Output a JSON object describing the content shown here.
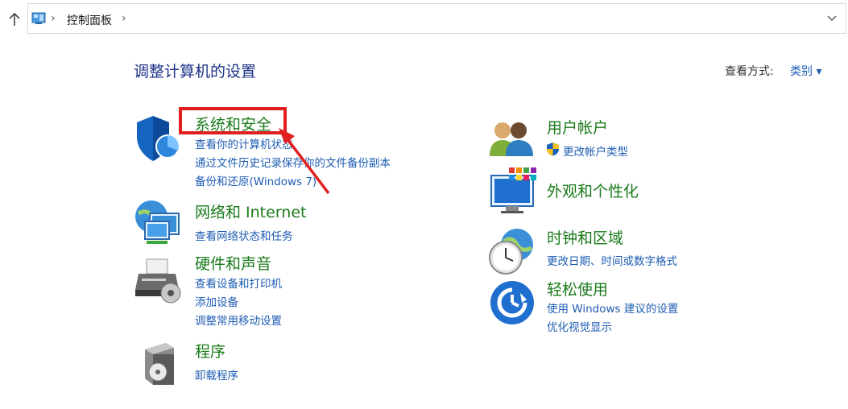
{
  "address": {
    "crumbs": [
      "控制面板"
    ]
  },
  "header": {
    "title": "调整计算机的设置",
    "view_by_label": "查看方式:",
    "view_by_value": "类别"
  },
  "left": [
    {
      "title": "系统和安全",
      "links": [
        "查看你的计算机状态",
        "通过文件历史记录保存你的文件备份副本",
        "备份和还原(Windows 7)"
      ]
    },
    {
      "title": "网络和 Internet",
      "links": [
        "查看网络状态和任务"
      ]
    },
    {
      "title": "硬件和声音",
      "links": [
        "查看设备和打印机",
        "添加设备",
        "调整常用移动设置"
      ]
    },
    {
      "title": "程序",
      "links": [
        "卸载程序"
      ]
    }
  ],
  "right": [
    {
      "title": "用户帐户",
      "links": [
        "更改帐户类型"
      ]
    },
    {
      "title": "外观和个性化",
      "links": []
    },
    {
      "title": "时钟和区域",
      "links": [
        "更改日期、时间或数字格式"
      ]
    },
    {
      "title": "轻松使用",
      "links": [
        "使用 Windows 建议的设置",
        "优化视觉显示"
      ]
    }
  ],
  "colors": {
    "category_title": "#1a7a1a",
    "link": "#1e5cb3",
    "page_title": "#1e3287",
    "highlight": "#e02020"
  }
}
